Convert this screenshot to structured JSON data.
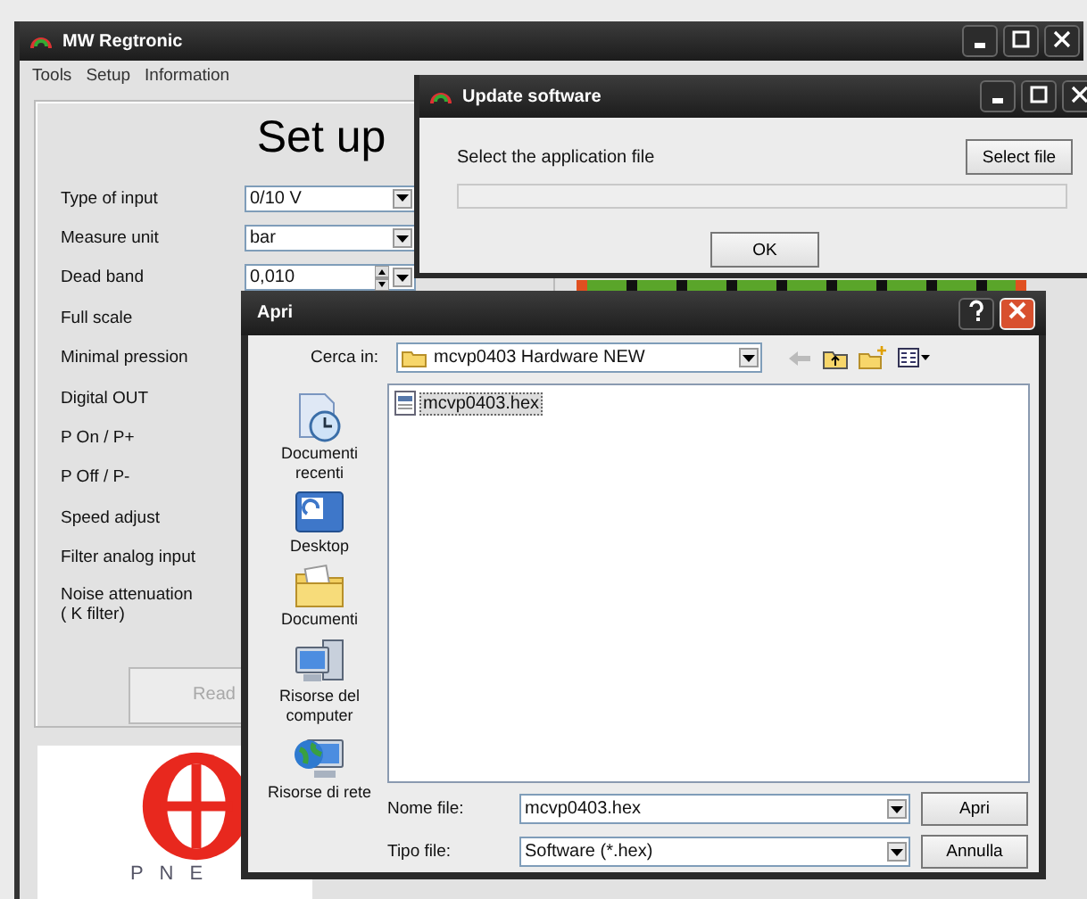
{
  "main_window": {
    "title": "MW Regtronic",
    "menu": [
      "Tools",
      "Setup",
      "Information"
    ],
    "setup": {
      "heading": "Set up",
      "fields": [
        {
          "label": "Type of input",
          "kind": "combo",
          "value": "0/10 V"
        },
        {
          "label": "Measure unit",
          "kind": "combo",
          "value": "bar"
        },
        {
          "label": "Dead band",
          "kind": "spin",
          "value": "0,010"
        },
        {
          "label": "Full scale",
          "kind": "none"
        },
        {
          "label": "Minimal pression",
          "kind": "none"
        },
        {
          "label": "Digital OUT",
          "kind": "none"
        },
        {
          "label": "P On / P+",
          "kind": "none"
        },
        {
          "label": "P Off / P-",
          "kind": "none"
        },
        {
          "label": "Speed adjust",
          "kind": "none"
        },
        {
          "label": "Filter analog input",
          "kind": "none"
        },
        {
          "label": "Noise attenuation\n( K filter)",
          "kind": "none"
        }
      ],
      "read_button": {
        "label": "Read",
        "disabled": true
      }
    },
    "logo_text": "P N E"
  },
  "update_dialog": {
    "title": "Update software",
    "prompt": "Select the application file",
    "select_button": "Select file",
    "progress": {
      "level": 0
    },
    "ok_button": "OK"
  },
  "open_dialog": {
    "title": "Apri",
    "look_in_label": "Cerca in:",
    "look_in_value": "mcvp0403 Hardware NEW",
    "places": [
      {
        "kind": "recent",
        "label": "Documenti recenti"
      },
      {
        "kind": "desktop",
        "label": "Desktop"
      },
      {
        "kind": "documents",
        "label": "Documenti"
      },
      {
        "kind": "computer",
        "label": "Risorse del computer"
      },
      {
        "kind": "network",
        "label": "Risorse di rete"
      }
    ],
    "files": [
      {
        "name": "mcvp0403.hex",
        "selected": true
      }
    ],
    "file_name_label": "Nome file:",
    "file_name_value": "mcvp0403.hex",
    "file_type_label": "Tipo file:",
    "file_type_value": "Software (*.hex)",
    "open_button": "Apri",
    "cancel_button": "Annulla"
  }
}
